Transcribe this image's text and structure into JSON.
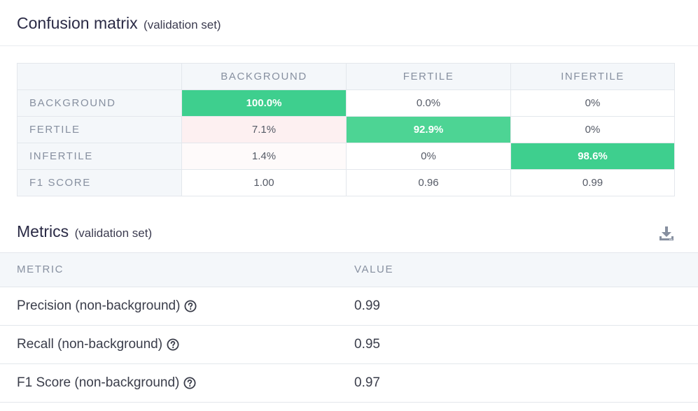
{
  "confusion": {
    "title": "Confusion matrix",
    "subtitle": "(validation set)",
    "columns": [
      "BACKGROUND",
      "FERTILE",
      "INFERTILE"
    ],
    "rows": [
      {
        "label": "BACKGROUND",
        "cells": [
          "100.0%",
          "0.0%",
          "0%"
        ]
      },
      {
        "label": "FERTILE",
        "cells": [
          "7.1%",
          "92.9%",
          "0%"
        ]
      },
      {
        "label": "INFERTILE",
        "cells": [
          "1.4%",
          "0%",
          "98.6%"
        ]
      },
      {
        "label": "F1 SCORE",
        "cells": [
          "1.00",
          "0.96",
          "0.99"
        ]
      }
    ]
  },
  "metrics": {
    "title": "Metrics",
    "subtitle": "(validation set)",
    "download_icon": "download-icon",
    "header": {
      "metric": "METRIC",
      "value": "VALUE"
    },
    "rows": [
      {
        "name": "Precision (non-background)",
        "value": "0.99",
        "icon": "help-circle-icon"
      },
      {
        "name": "Recall (non-background)",
        "value": "0.95",
        "icon": "help-circle-icon"
      },
      {
        "name": "F1 Score (non-background)",
        "value": "0.97",
        "icon": "help-circle-icon"
      }
    ]
  },
  "colors": {
    "diagonal": "#3ecf8e",
    "error_tint": "#fdf0f1",
    "header_bg": "#f4f7fa"
  }
}
